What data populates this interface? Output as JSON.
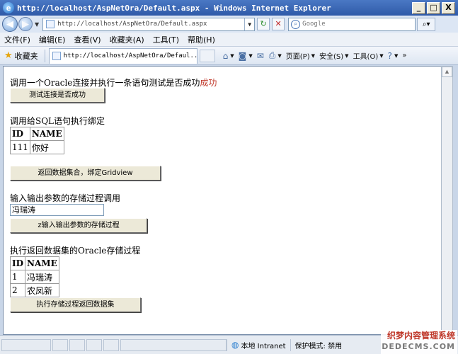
{
  "window": {
    "title": "http://localhost/AspNetOra/Default.aspx - Windows Internet Explorer",
    "minimize": "_",
    "maximize": "□",
    "close": "X"
  },
  "address": {
    "url": "http://localhost/AspNetOra/Default.aspx",
    "search_placeholder": "Google"
  },
  "menu": [
    "文件(F)",
    "编辑(E)",
    "查看(V)",
    "收藏夹(A)",
    "工具(T)",
    "帮助(H)"
  ],
  "favbar": {
    "favorites": "收藏夹",
    "tab_title": "http://localhost/AspNetOra/Defaul...",
    "page_menu": "页面(P)",
    "safety_menu": "安全(S)",
    "tools_menu": "工具(O)"
  },
  "page": {
    "s1_text": "调用一个Oracle连接并执行一条语句测试是否成功",
    "s1_result": "成功",
    "s1_button": "测试连接是否成功",
    "s2_text": "调用给SQL语句执行绑定",
    "grid1": {
      "headers": [
        "ID",
        "NAME"
      ],
      "rows": [
        [
          "111",
          "你好"
        ]
      ]
    },
    "s2_button": "返回数据集合，绑定Gridview",
    "s3_text": "输入输出参数的存储过程调用",
    "s3_input": "冯瑞涛",
    "s3_button": "z输入输出参数的存储过程",
    "s4_text": "执行返回数据集的Oracle存储过程",
    "grid2": {
      "headers": [
        "ID",
        "NAME"
      ],
      "rows": [
        [
          "1",
          "冯瑞涛"
        ],
        [
          "2",
          "农凤新"
        ]
      ]
    },
    "s4_button": "执行存储过程返回数据集"
  },
  "status": {
    "zone": "本地 Intranet",
    "mode": "保护模式: 禁用"
  },
  "watermark": {
    "line1": "织梦内容管理系统",
    "line2": "DEDECMS.COM"
  }
}
